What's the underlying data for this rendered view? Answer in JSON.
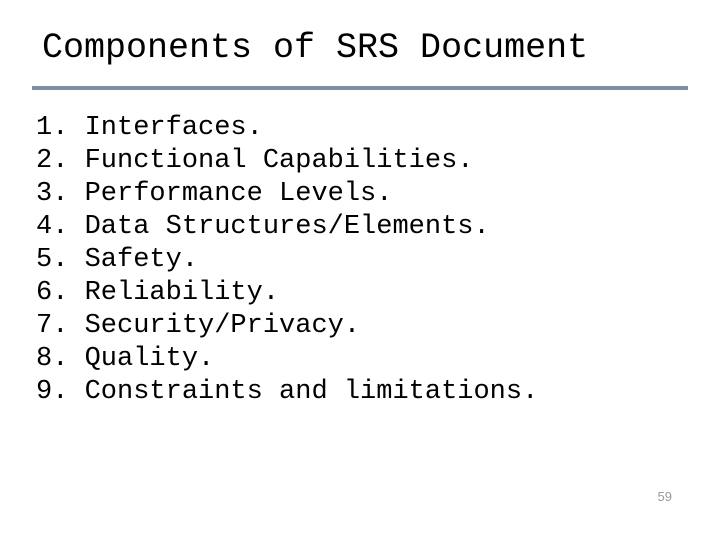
{
  "title": "Components of SRS Document",
  "items": [
    {
      "num": "1.",
      "text": "Interfaces."
    },
    {
      "num": "2.",
      "text": "Functional Capabilities."
    },
    {
      "num": "3.",
      "text": "Performance Levels."
    },
    {
      "num": "4.",
      "text": "Data Structures/Elements."
    },
    {
      "num": "5.",
      "text": "Safety."
    },
    {
      "num": "6.",
      "text": "Reliability."
    },
    {
      "num": "7.",
      "text": "Security/Privacy."
    },
    {
      "num": "8.",
      "text": "Quality."
    },
    {
      "num": "9.",
      "text": "Constraints and limitations."
    }
  ],
  "page_number": "59"
}
